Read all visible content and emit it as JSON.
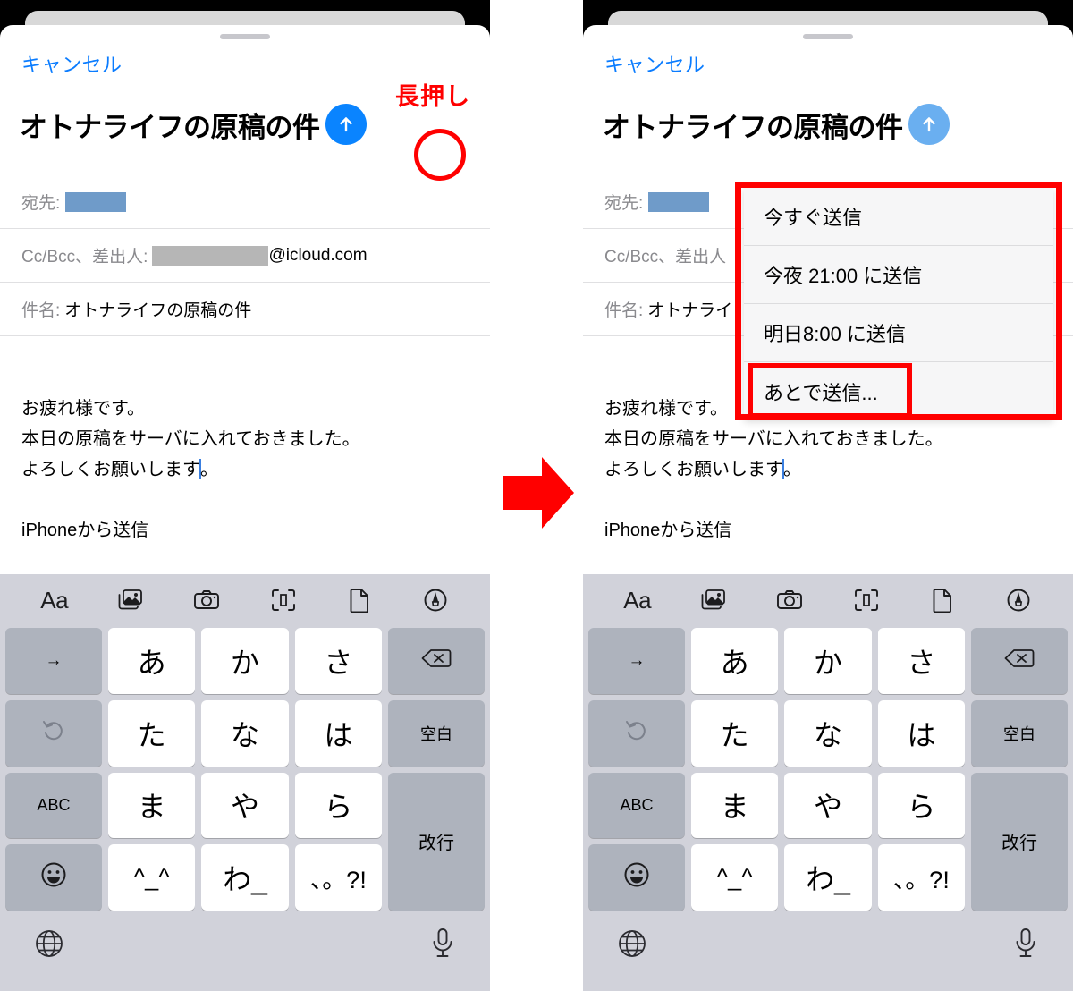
{
  "annotations": {
    "long_press_label": "長押し",
    "flow_arrow": "arrow-right"
  },
  "left_panel": {
    "cancel_label": "キャンセル",
    "title": "オトナライフの原稿の件",
    "send_icon": "arrow-up-icon",
    "fields": [
      {
        "label": "宛先:",
        "value": "",
        "redacted": "blue"
      },
      {
        "label": "Cc/Bcc、差出人:",
        "value": "@icloud.com",
        "redacted": "gray"
      },
      {
        "label": "件名:",
        "value": "オトナライフの原稿の件",
        "redacted": "none"
      }
    ],
    "body_lines": [
      "お疲れ様です。",
      "本日の原稿をサーバに入れておきました。",
      "よろしくお願いします。"
    ],
    "signature": "iPhoneから送信"
  },
  "right_panel": {
    "cancel_label": "キャンセル",
    "title": "オトナライフの原稿の件",
    "send_icon": "arrow-up-icon",
    "fields": [
      {
        "label": "宛先:",
        "value": "",
        "redacted": "blue"
      },
      {
        "label": "Cc/Bcc、差出人",
        "value": "",
        "redacted": "none"
      },
      {
        "label": "件名:",
        "value": "オトナライ",
        "redacted": "none"
      }
    ],
    "body_lines": [
      "お疲れ様です。",
      "本日の原稿をサーバに入れておきました。",
      "よろしくお願いします。"
    ],
    "signature": "iPhoneから送信",
    "send_menu": {
      "items": [
        "今すぐ送信",
        "今夜 21:00 に送信",
        "明日8:00 に送信",
        "あとで送信..."
      ],
      "highlighted_index": 3
    }
  },
  "keyboard": {
    "toolbar": [
      {
        "name": "text-format-icon",
        "label": "Aa"
      },
      {
        "name": "photos-icon",
        "label": ""
      },
      {
        "name": "camera-icon",
        "label": ""
      },
      {
        "name": "document-scan-icon",
        "label": ""
      },
      {
        "name": "document-icon",
        "label": ""
      },
      {
        "name": "markup-pen-icon",
        "label": ""
      }
    ],
    "keys": {
      "arrow_right": "→",
      "a": "あ",
      "ka": "か",
      "sa": "さ",
      "delete": "delete-icon",
      "undo": "undo-icon",
      "ta": "た",
      "na": "な",
      "ha": "は",
      "space": "空白",
      "abc": "ABC",
      "ma": "ま",
      "ya": "や",
      "ra": "ら",
      "return": "改行",
      "emoji": "emoji-icon",
      "kaomoji": "^_^",
      "wa": "わ_",
      "punct": "、。?!"
    },
    "bottom": {
      "globe": "globe-icon",
      "mic": "microphone-icon"
    }
  },
  "colors": {
    "accent_blue": "#0a84ff",
    "link_blue": "#0a7cff",
    "annotation_red": "#ff0000",
    "keyboard_bg": "#d1d2da",
    "key_fn_bg": "#aeb3bd"
  }
}
